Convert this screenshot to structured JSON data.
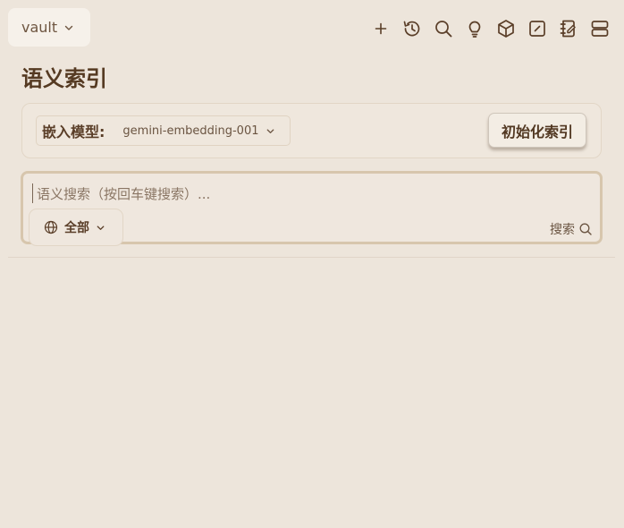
{
  "header": {
    "vault_label": "vault",
    "icons": [
      "plus-icon",
      "history-icon",
      "search-icon",
      "lightbulb-icon",
      "cube-icon",
      "edit-square-icon",
      "notebook-icon",
      "server-icon"
    ]
  },
  "page": {
    "title": "语义索引"
  },
  "model_panel": {
    "label": "嵌入模型:",
    "model_value": "gemini-embedding-001",
    "init_button": "初始化索引"
  },
  "search": {
    "placeholder": "语义搜索（按回车键搜索）...",
    "scope_label": "全部",
    "search_button": "搜索"
  },
  "colors": {
    "background": "#ede5db",
    "text_primary": "#5a3e28",
    "focus_border": "#d7c6ad"
  }
}
